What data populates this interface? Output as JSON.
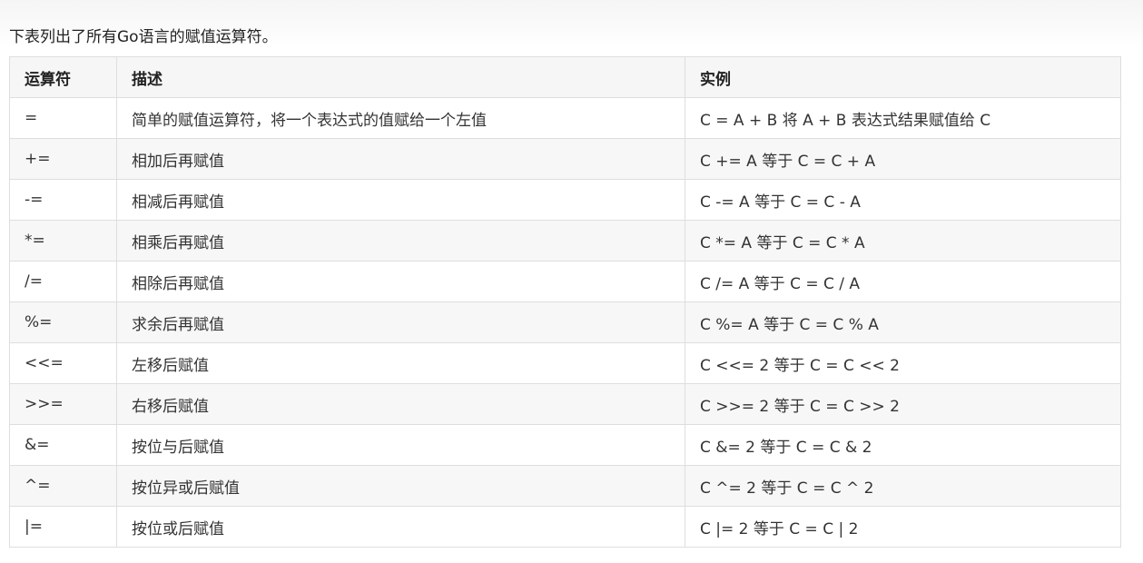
{
  "intro": "下表列出了所有Go语言的赋值运算符。",
  "table": {
    "headers": [
      "运算符",
      "描述",
      "实例"
    ],
    "rows": [
      [
        "=",
        "简单的赋值运算符，将一个表达式的值赋给一个左值",
        "C = A + B 将 A + B 表达式结果赋值给 C"
      ],
      [
        "+=",
        "相加后再赋值",
        "C += A 等于 C = C + A"
      ],
      [
        "-=",
        "相减后再赋值",
        "C -= A 等于 C = C - A"
      ],
      [
        "*=",
        "相乘后再赋值",
        "C *= A 等于 C = C * A"
      ],
      [
        "/=",
        "相除后再赋值",
        "C /= A 等于 C = C / A"
      ],
      [
        "%=",
        "求余后再赋值",
        "C %= A 等于 C = C % A"
      ],
      [
        "<<=",
        "左移后赋值",
        "C <<= 2 等于 C = C << 2"
      ],
      [
        ">>=",
        "右移后赋值",
        "C >>= 2 等于 C = C >> 2"
      ],
      [
        "&=",
        "按位与后赋值",
        "C &= 2 等于 C = C & 2"
      ],
      [
        "^=",
        "按位异或后赋值",
        "C ^= 2 等于 C = C ^ 2"
      ],
      [
        "|=",
        "按位或后赋值",
        "C |= 2 等于 C = C | 2"
      ]
    ]
  }
}
